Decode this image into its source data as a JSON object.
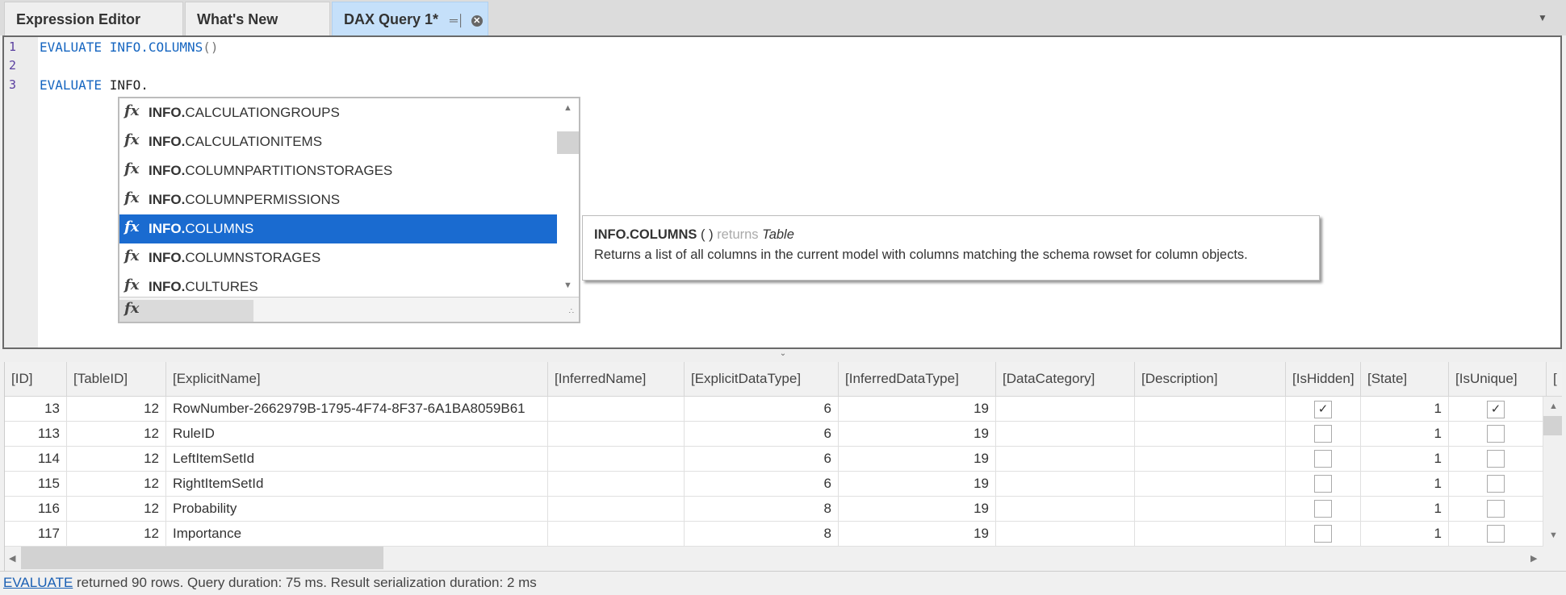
{
  "tabs": [
    {
      "label": "Expression Editor"
    },
    {
      "label": "What's New"
    },
    {
      "label": "DAX Query 1*",
      "active": true
    }
  ],
  "editor": {
    "lines": [
      {
        "num": "1",
        "kw": "EVALUATE",
        "fn": "INFO.COLUMNS",
        "par": "()"
      },
      {
        "num": "2"
      },
      {
        "num": "3",
        "kw": "EVALUATE",
        "plain": "INFO."
      }
    ]
  },
  "autocomplete": {
    "items": [
      {
        "prefix": "INFO.",
        "rest": "CALCULATIONGROUPS"
      },
      {
        "prefix": "INFO.",
        "rest": "CALCULATIONITEMS"
      },
      {
        "prefix": "INFO.",
        "rest": "COLUMNPARTITIONSTORAGES"
      },
      {
        "prefix": "INFO.",
        "rest": "COLUMNPERMISSIONS"
      },
      {
        "prefix": "INFO.",
        "rest": "COLUMNS",
        "selected": true
      },
      {
        "prefix": "INFO.",
        "rest": "COLUMNSTORAGES"
      },
      {
        "prefix": "INFO.",
        "rest": "CULTURES"
      }
    ],
    "icon": "fx",
    "footer_icon": "fx"
  },
  "tooltip": {
    "name": "INFO.COLUMNS",
    "params": "( )",
    "returns_label": "returns",
    "return_type": "Table",
    "description": "Returns a list of all columns in the current model with columns matching the schema rowset for column objects."
  },
  "grid": {
    "columns": [
      "[ID]",
      "[TableID]",
      "[ExplicitName]",
      "[InferredName]",
      "[ExplicitDataType]",
      "[InferredDataType]",
      "[DataCategory]",
      "[Description]",
      "[IsHidden]",
      "[State]",
      "[IsUnique]",
      "["
    ],
    "rows": [
      [
        "13",
        "12",
        "RowNumber-2662979B-1795-4F74-8F37-6A1BA8059B61",
        "",
        "6",
        "19",
        "",
        "",
        true,
        "1",
        true
      ],
      [
        "113",
        "12",
        "RuleID",
        "",
        "6",
        "19",
        "",
        "",
        false,
        "1",
        false
      ],
      [
        "114",
        "12",
        "LeftItemSetId",
        "",
        "6",
        "19",
        "",
        "",
        false,
        "1",
        false
      ],
      [
        "115",
        "12",
        "RightItemSetId",
        "",
        "6",
        "19",
        "",
        "",
        false,
        "1",
        false
      ],
      [
        "116",
        "12",
        "Probability",
        "",
        "8",
        "19",
        "",
        "",
        false,
        "1",
        false
      ],
      [
        "117",
        "12",
        "Importance",
        "",
        "8",
        "19",
        "",
        "",
        false,
        "1",
        false
      ]
    ]
  },
  "status": {
    "link": "EVALUATE",
    "text": " returned 90 rows. Query duration: 75 ms. Result serialization duration: 2 ms"
  }
}
